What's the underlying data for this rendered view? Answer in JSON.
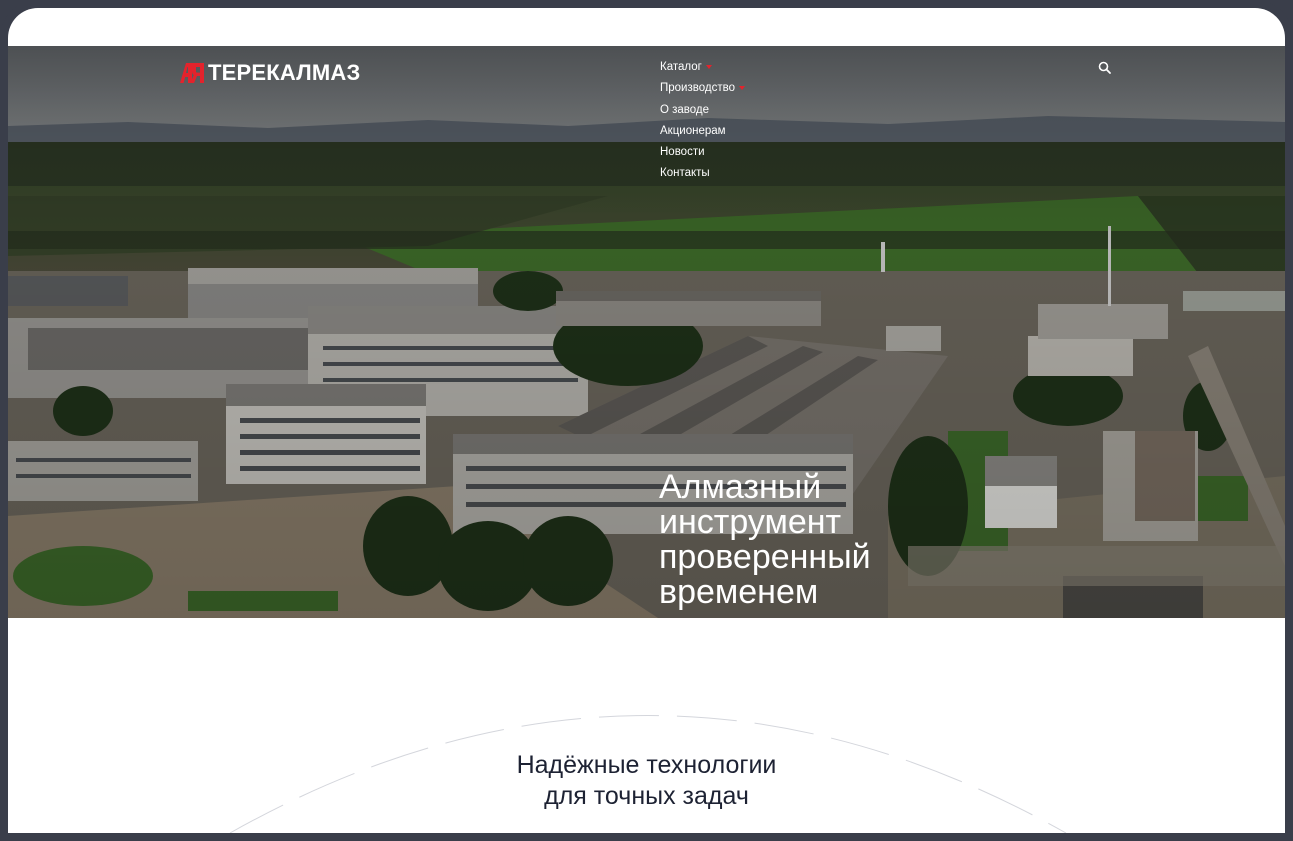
{
  "header": {
    "logo_text": "ТЕРЕКАЛМАЗ",
    "logo_icon": "terekalmaz-logo-mark",
    "nav": [
      {
        "label": "Каталог",
        "has_dropdown": true
      },
      {
        "label": "Производство",
        "has_dropdown": true
      },
      {
        "label": "О заводе",
        "has_dropdown": false
      },
      {
        "label": "Акционерам",
        "has_dropdown": false
      },
      {
        "label": "Новости",
        "has_dropdown": false
      },
      {
        "label": "Контакты",
        "has_dropdown": false
      }
    ],
    "search_icon": "search-icon"
  },
  "hero": {
    "title_lines": [
      "Алмазный",
      "инструмент",
      "проверенный",
      "временем"
    ],
    "image": "aerial-factory-photo"
  },
  "intro": {
    "title_lines": [
      "Надёжные технологии",
      "для точных задач"
    ]
  },
  "colors": {
    "brand_red": "#e3232c",
    "heading_dark": "#1d2233",
    "frame": "#3a3e4a"
  }
}
